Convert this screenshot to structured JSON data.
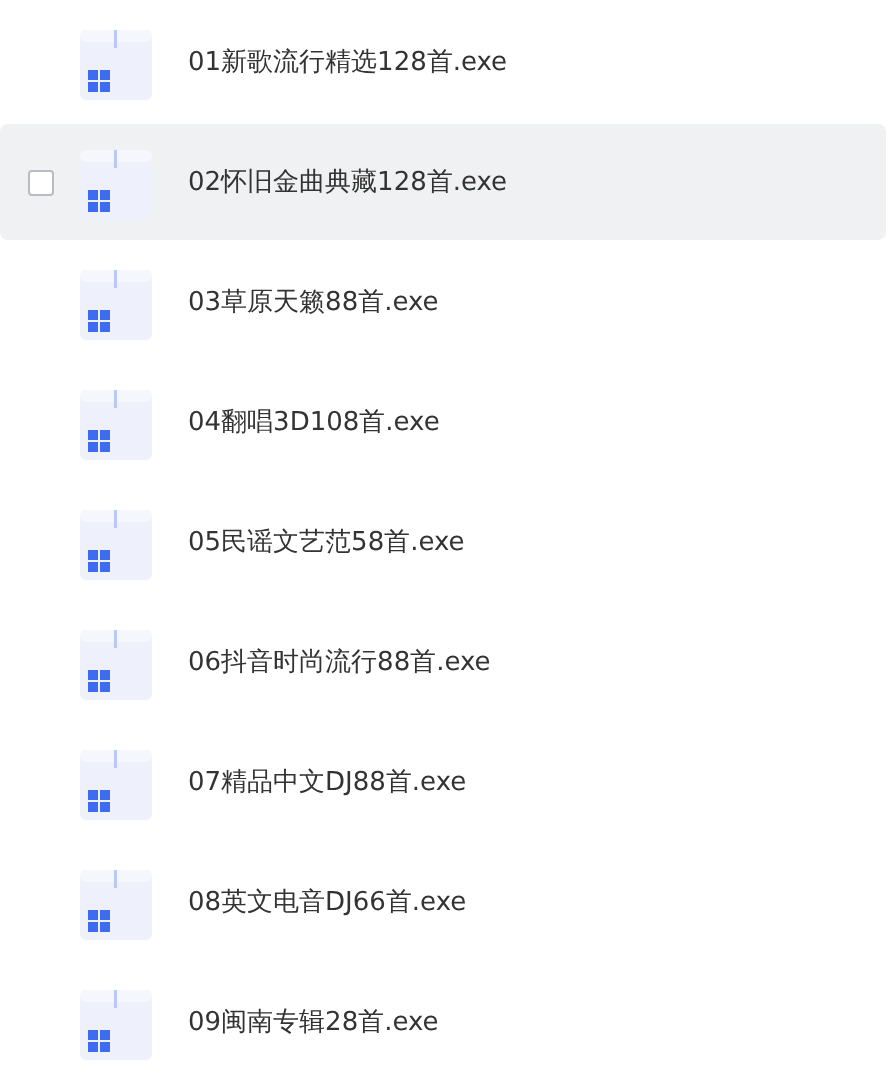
{
  "files": [
    {
      "name": "01新歌流行精选128首.exe",
      "hovered": false,
      "checked": false
    },
    {
      "name": "02怀旧金曲典藏128首.exe",
      "hovered": true,
      "checked": false
    },
    {
      "name": "03草原天籁88首.exe",
      "hovered": false,
      "checked": false
    },
    {
      "name": "04翻唱3D108首.exe",
      "hovered": false,
      "checked": false
    },
    {
      "name": "05民谣文艺范58首.exe",
      "hovered": false,
      "checked": false
    },
    {
      "name": "06抖音时尚流行88首.exe",
      "hovered": false,
      "checked": false
    },
    {
      "name": "07精品中文DJ88首.exe",
      "hovered": false,
      "checked": false
    },
    {
      "name": "08英文电音DJ66首.exe",
      "hovered": false,
      "checked": false
    },
    {
      "name": "09闽南专辑28首.exe",
      "hovered": false,
      "checked": false
    }
  ]
}
